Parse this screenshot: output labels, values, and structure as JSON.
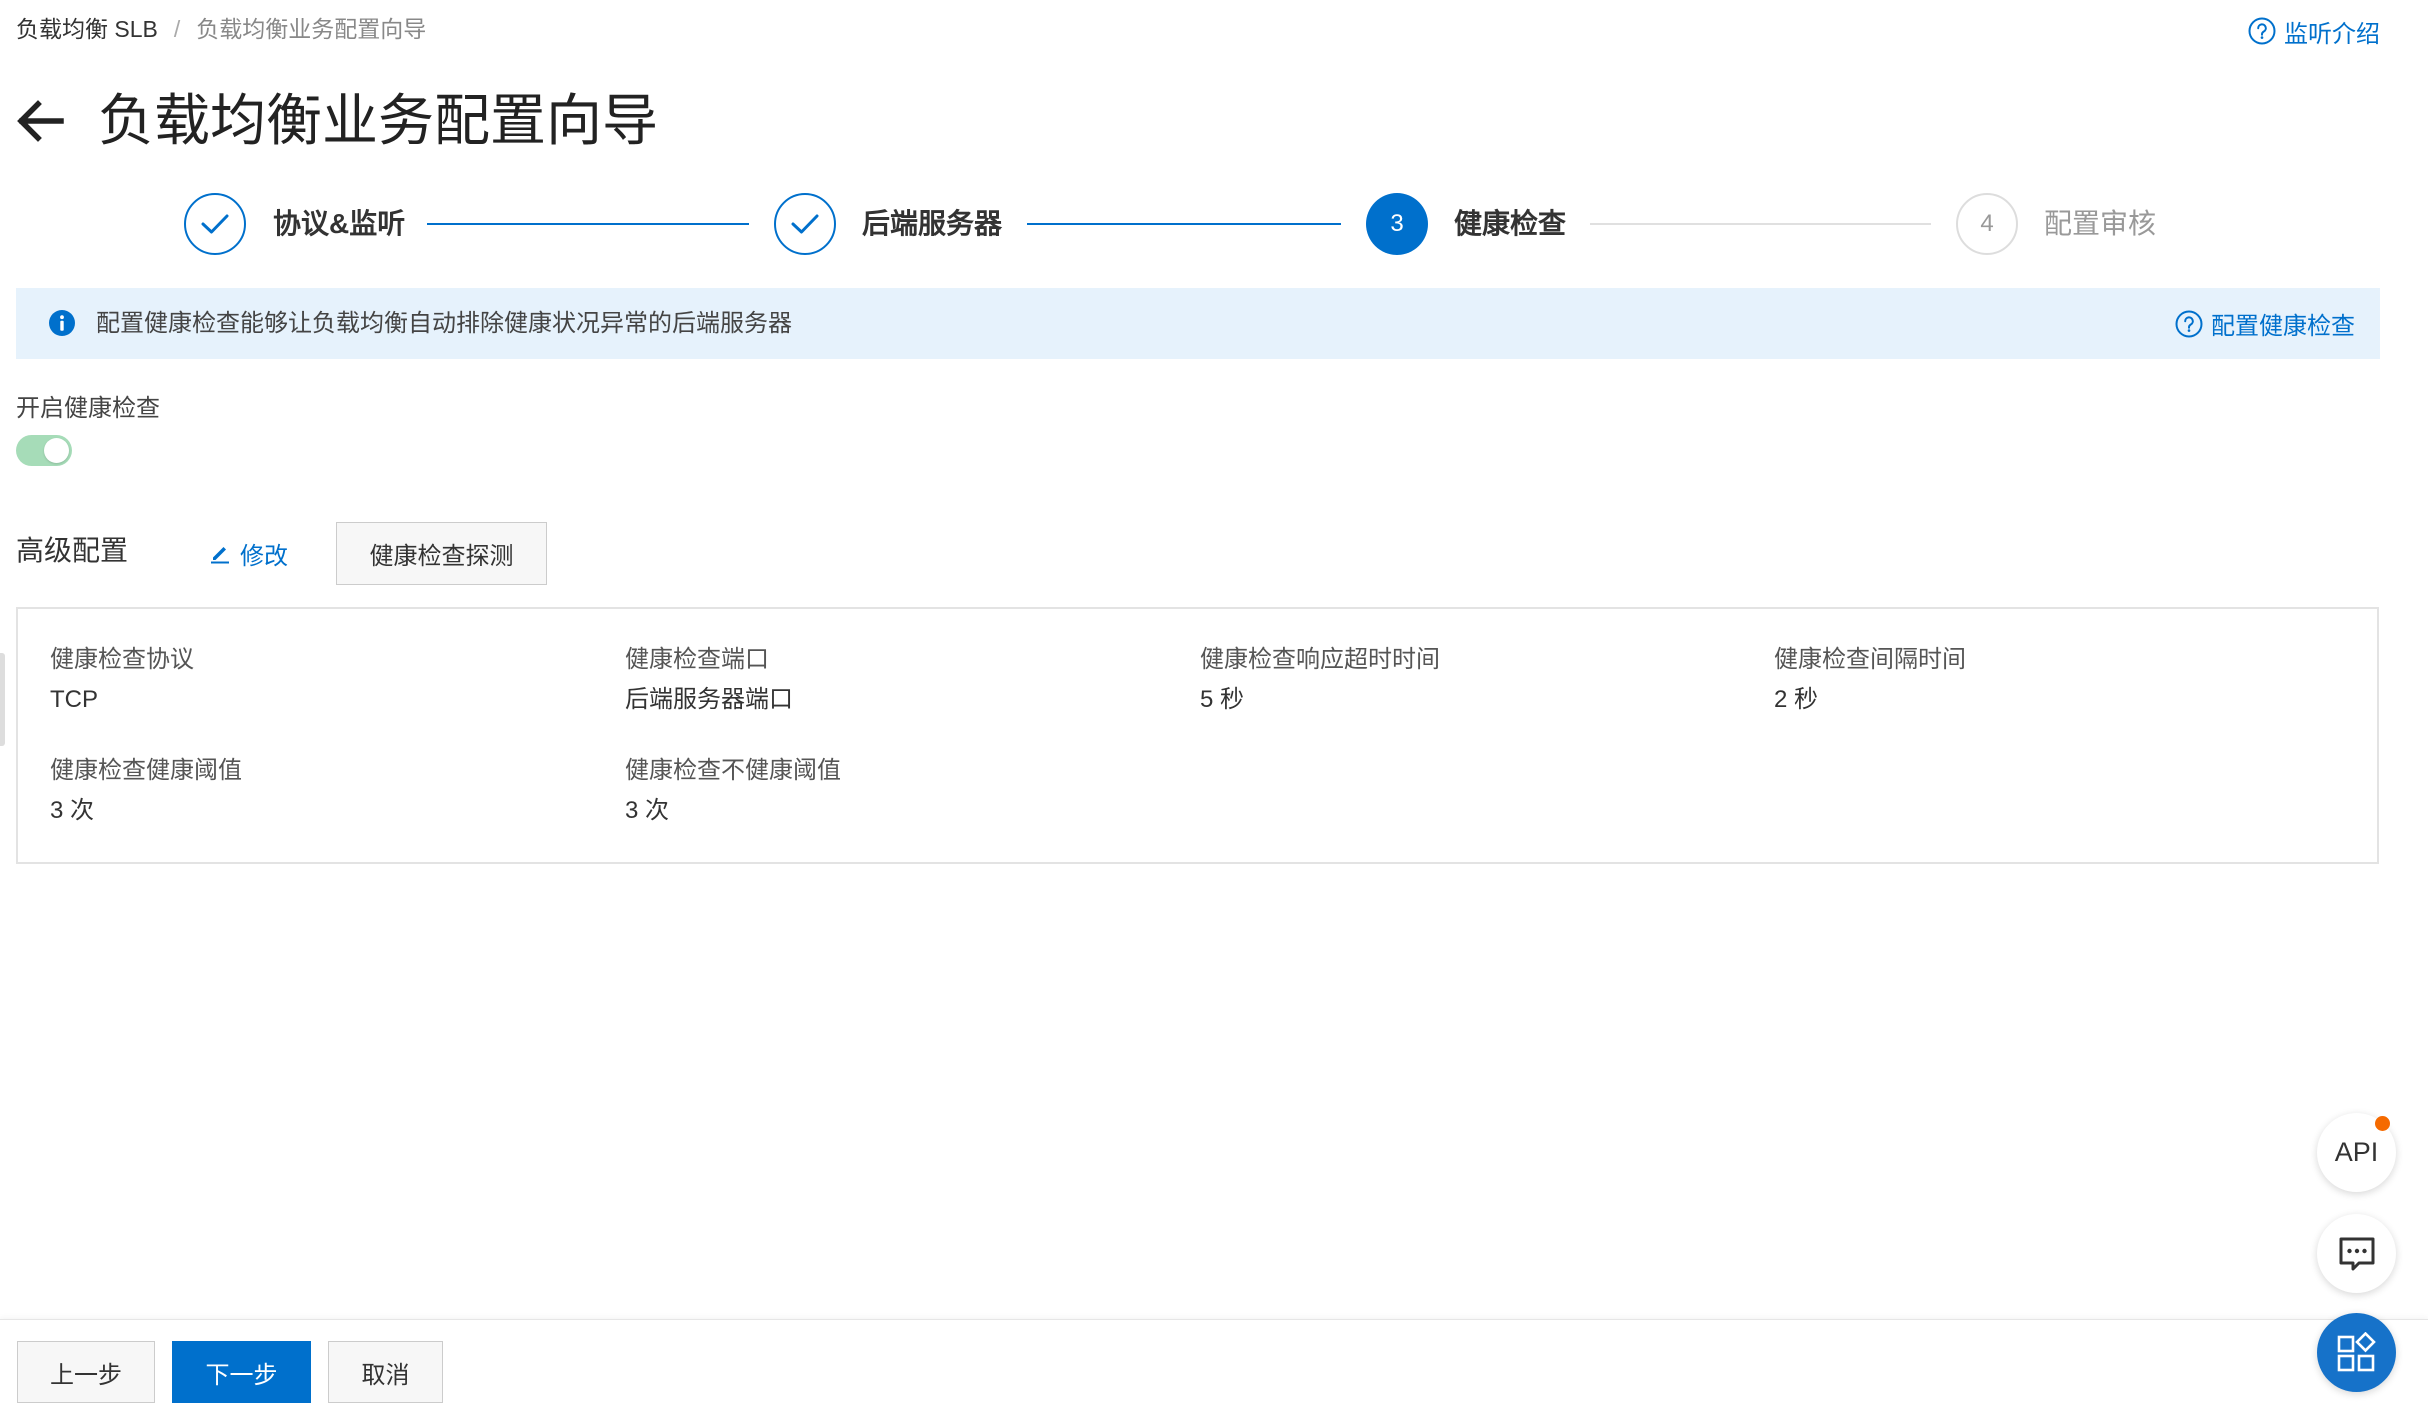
{
  "breadcrumb": {
    "items": [
      "负载均衡 SLB",
      "负载均衡业务配置向导"
    ],
    "separator": "/"
  },
  "help_link": {
    "label": "监听介绍",
    "icon": "question-circle-icon"
  },
  "page": {
    "title": "负载均衡业务配置向导",
    "back_icon": "arrow-left-icon"
  },
  "steps": [
    {
      "label": "协议&监听",
      "completed": true,
      "icon": "check-icon"
    },
    {
      "label": "后端服务器",
      "completed": true,
      "icon": "check-icon"
    },
    {
      "label": "健康检查",
      "number": "3",
      "active": true
    },
    {
      "label": "配置审核",
      "number": "4",
      "active": false
    }
  ],
  "info_banner": {
    "icon": "info-circle-icon",
    "text": "配置健康检查能够让负载均衡自动排除健康状况异常的后端服务器",
    "link_label": "配置健康检查"
  },
  "health_check": {
    "toggle_label": "开启健康检查",
    "enabled": true
  },
  "advanced": {
    "title": "高级配置",
    "edit_label": "修改",
    "edit_icon": "pencil-icon",
    "probe_button_label": "健康检查探测"
  },
  "details": [
    {
      "label": "健康检查协议",
      "value": "TCP"
    },
    {
      "label": "健康检查端口",
      "value": "后端服务器端口"
    },
    {
      "label": "健康检查响应超时时间",
      "value": "5 秒"
    },
    {
      "label": "健康检查间隔时间",
      "value": "2 秒"
    },
    {
      "label": "健康检查健康阈值",
      "value": "3 次"
    },
    {
      "label": "健康检查不健康阈值",
      "value": "3 次"
    }
  ],
  "footer": {
    "prev_label": "上一步",
    "next_label": "下一步",
    "cancel_label": "取消"
  },
  "floating": {
    "api_label": "API",
    "api_has_notification": true,
    "chat_icon": "chat-bubble-icon",
    "apps_icon": "apps-grid-icon"
  },
  "colors": {
    "primary": "#0070cc",
    "toggle_on": "#a6dcb8",
    "banner_bg": "#e6f2fc",
    "notification": "#f56a00"
  }
}
